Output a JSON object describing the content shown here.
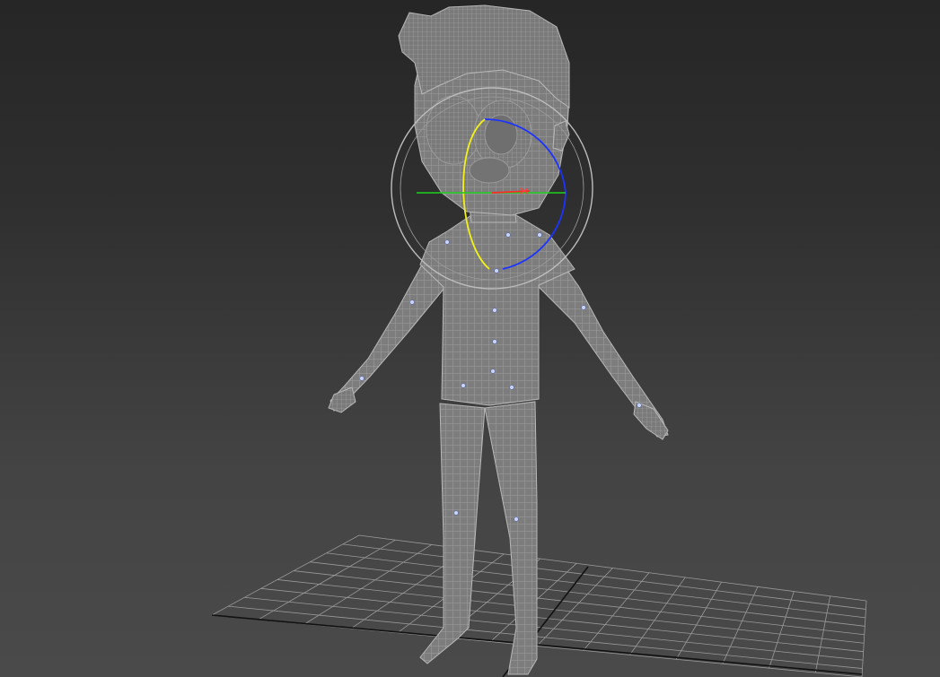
{
  "viewport": {
    "background_top": "#262626",
    "background_bottom": "#4a4a4a"
  },
  "grid": {
    "line_color": "#9a9a9a",
    "axis_color": "#111111"
  },
  "model": {
    "mesh_fill": "#7d7d7d",
    "wire_color": "#a9a9a9",
    "outline_color": "#b8b8b8",
    "bone_marker_color": "#c8d4ff"
  },
  "gizmo": {
    "mode": "rotate",
    "outer_ring_color": "#bdbdbd",
    "x_axis_color": "#ff2a2a",
    "y_axis_color": "#1fd21f",
    "z_axis_color": "#1c33ff",
    "view_ring_color": "#f2f21a"
  }
}
